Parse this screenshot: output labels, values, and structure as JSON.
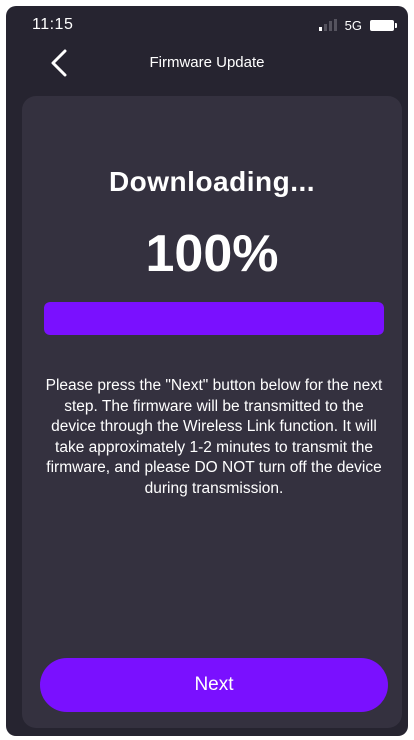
{
  "status_bar": {
    "time": "11:15",
    "network": "5G",
    "icons": [
      "signal-icon",
      "battery-icon"
    ]
  },
  "nav": {
    "title": "Firmware Update",
    "back_icon": "chevron-left-icon"
  },
  "download": {
    "heading": "Downloading...",
    "percent_label": "100%",
    "progress_fraction": 1.0
  },
  "instructions": "Please press the \"Next\" button below for the next step. The firmware will be transmitted to the device through the Wireless Link function. It will take approximately 1-2 minutes to transmit the firmware, and please DO NOT turn off the device during transmission.",
  "actions": {
    "next_label": "Next"
  },
  "colors": {
    "background": "#262430",
    "card": "#34313f",
    "accent": "#7a10ff",
    "text": "#ffffff"
  }
}
